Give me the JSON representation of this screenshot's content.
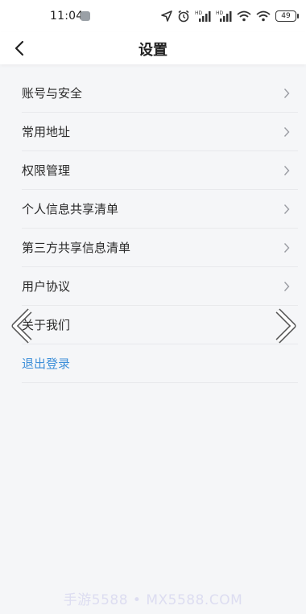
{
  "status_bar": {
    "time": "11:04",
    "battery_level": "49",
    "icons": [
      "location-icon",
      "alarm-icon",
      "signal-hd-icon",
      "signal-hd-icon",
      "wifi-icon",
      "wifi-icon",
      "battery-icon"
    ]
  },
  "header": {
    "title": "设置",
    "back_icon": "chevron-left-icon"
  },
  "settings": {
    "items": [
      {
        "label": "账号与安全"
      },
      {
        "label": "常用地址"
      },
      {
        "label": "权限管理"
      },
      {
        "label": "个人信息共享清单"
      },
      {
        "label": "第三方共享信息清单"
      },
      {
        "label": "用户协议"
      },
      {
        "label": "关于我们"
      }
    ],
    "logout_label": "退出登录"
  },
  "colors": {
    "background": "#f5f6f8",
    "header": "#ffffff",
    "link_blue": "#3d8fd9",
    "divider": "#e8e9ec"
  },
  "watermark": "手游5588 • MX5588.COM"
}
